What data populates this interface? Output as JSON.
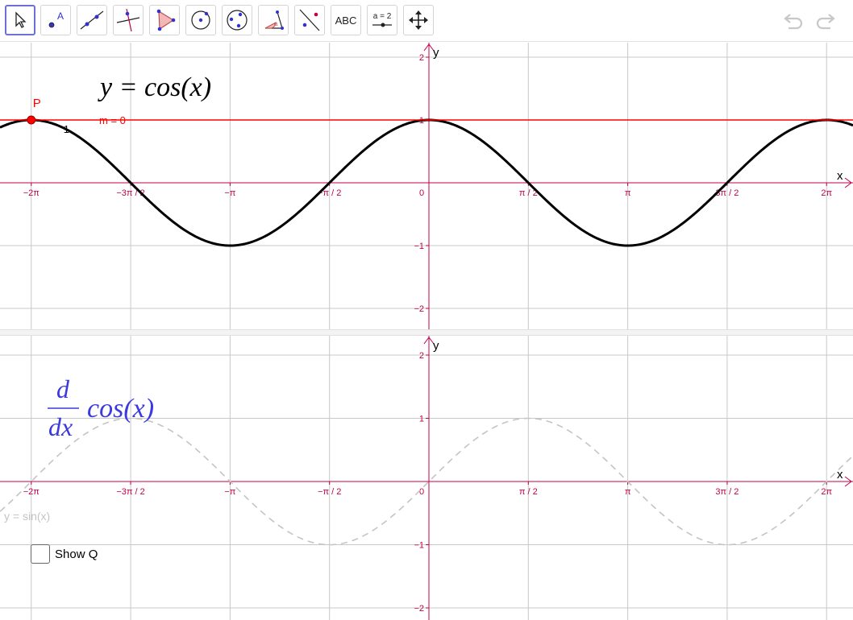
{
  "toolbar": {
    "tools": [
      {
        "name": "move-tool",
        "label": ""
      },
      {
        "name": "point-tool",
        "label": ""
      },
      {
        "name": "line-tool",
        "label": ""
      },
      {
        "name": "perpendicular-line-tool",
        "label": ""
      },
      {
        "name": "polygon-tool",
        "label": ""
      },
      {
        "name": "circle-center-point-tool",
        "label": ""
      },
      {
        "name": "circle-three-points-tool",
        "label": ""
      },
      {
        "name": "angle-tool",
        "label": ""
      },
      {
        "name": "reflect-tool",
        "label": ""
      },
      {
        "name": "text-tool",
        "label": "ABC"
      },
      {
        "name": "slider-tool",
        "label": "a = 2"
      },
      {
        "name": "move-graphics-view-tool",
        "label": ""
      }
    ],
    "undo_icon": "undo-icon",
    "redo_icon": "redo-icon"
  },
  "colors": {
    "axis": "#c0004a",
    "grid": "#c8c8c8",
    "curve": "#000000",
    "tangent": "#ff0000",
    "point": "#ff0000",
    "derivative_title": "#3a3adf",
    "sin_curve": "#c4c4c4"
  },
  "view1": {
    "y_axis_label": "y",
    "x_axis_label": "x",
    "x_ticks": [
      "−2π",
      "−3π / 2",
      "−π",
      "−π / 2",
      "0",
      "π / 2",
      "π",
      "3π / 2",
      "2π"
    ],
    "y_ticks": [
      "2",
      "1",
      "−1",
      "−2"
    ],
    "function_title": "y = cos(x)",
    "point_label": "P",
    "slope_label": "m = 0",
    "tangent_tick_label": "1",
    "point_x_value": -6.2832,
    "slope_value": 0
  },
  "view2": {
    "y_axis_label": "y",
    "x_axis_label": "x",
    "x_ticks": [
      "−2π",
      "−3π / 2",
      "−π",
      "−π / 2",
      "0",
      "π / 2",
      "π",
      "3π / 2",
      "2π"
    ],
    "y_ticks": [
      "2",
      "1",
      "−1",
      "−2"
    ],
    "derivative_numerator": "d",
    "derivative_denominator": "dx",
    "derivative_function": "cos(x)",
    "sin_label": "y = sin(x)",
    "checkbox_label": "Show Q",
    "checkbox_checked": false
  }
}
